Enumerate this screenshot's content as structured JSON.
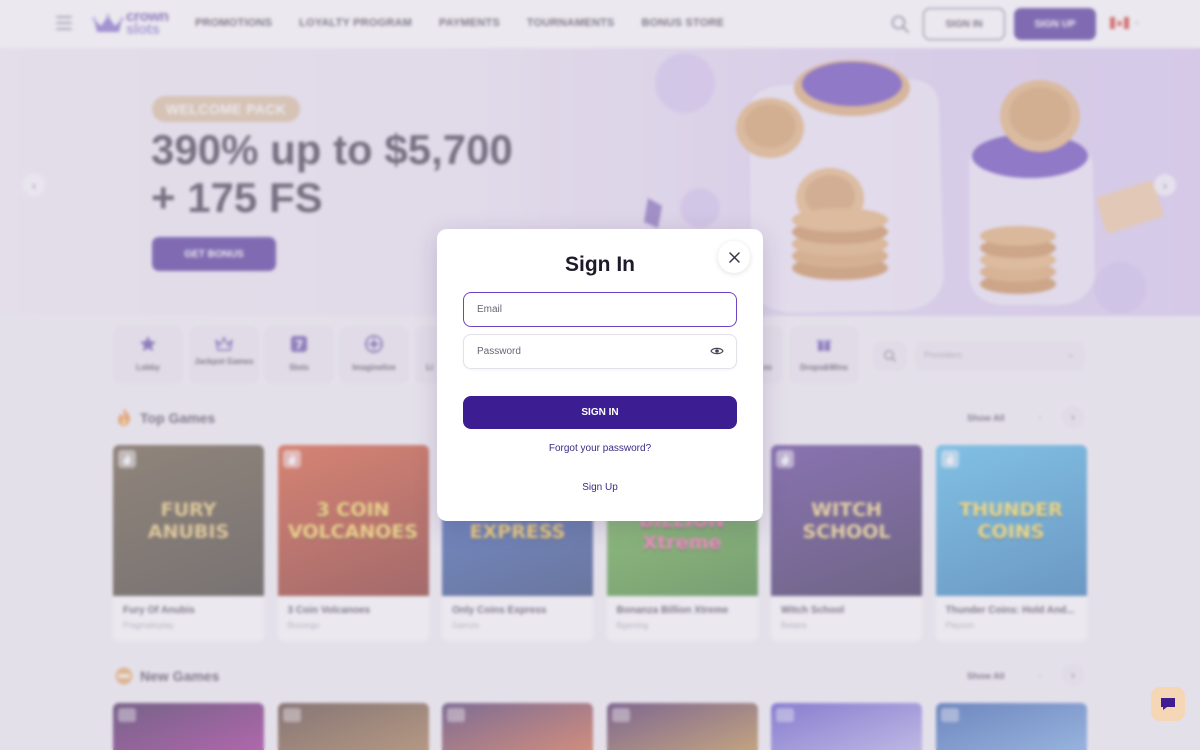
{
  "header": {
    "logo_line1": "crown",
    "logo_line2": "slots",
    "nav": [
      "PROMOTIONS",
      "LOYALTY PROGRAM",
      "PAYMENTS",
      "TOURNAMENTS",
      "BONUS STORE"
    ],
    "sign_in": "SIGN IN",
    "sign_up": "SIGN UP",
    "country_flag": "canada-flag-icon"
  },
  "hero": {
    "badge": "WELCOME PACK",
    "headline_line1": "390% up to $5,700",
    "headline_line2": "+ 175 FS",
    "cta": "GET BONUS"
  },
  "categories": [
    {
      "label": "Lobby",
      "icon": "star-icon"
    },
    {
      "label": "Jackpot Games",
      "icon": "crown-icon"
    },
    {
      "label": "Slots",
      "icon": "slot-7-icon"
    },
    {
      "label": "Imaginelive",
      "icon": "roulette-icon"
    },
    {
      "label": "Li",
      "icon": "live-icon"
    },
    {
      "label": "es",
      "icon": "games-icon"
    },
    {
      "label": "Drops&Wins",
      "icon": "drops-icon"
    }
  ],
  "providers_placeholder": "Providers",
  "top_games": {
    "title": "Top Games",
    "show_all": "Show All",
    "games": [
      {
        "name": "Fury Of Anubis",
        "provider": "Pragmaticplay",
        "art": "FURY ANUBIS",
        "c1": "#5a4a2c",
        "c2": "#2e2a1e",
        "fg": "#e8c66a"
      },
      {
        "name": "3 Coin Volcanoes",
        "provider": "Booongo",
        "art": "3 COIN VOLCANOES",
        "c1": "#d8481f",
        "c2": "#7c1a0f",
        "fg": "#ffd64a"
      },
      {
        "name": "Only Coins Express",
        "provider": "Gamzix",
        "art": "ONLY COINS EXPRESS",
        "c1": "#2a5ec4",
        "c2": "#16306e",
        "fg": "#ffcf3f"
      },
      {
        "name": "Bonanza Billion Xtreme",
        "provider": "Bgaming",
        "art": "BONANZA BILLION Xtreme",
        "c1": "#6cc13a",
        "c2": "#2c7a1e",
        "fg": "#ff5ea8"
      },
      {
        "name": "Witch School",
        "provider": "Belatra",
        "art": "WITCH SCHOOL",
        "c1": "#4e2a8e",
        "c2": "#1d1140",
        "fg": "#f2d37c"
      },
      {
        "name": "Thunder Coins: Hold And...",
        "provider": "Playson",
        "art": "THUNDER COINS",
        "c1": "#3fb6ea",
        "c2": "#186fb0",
        "fg": "#ffe042"
      }
    ]
  },
  "new_games": {
    "title": "New Games",
    "show_all": "Show All",
    "thumbs": [
      {
        "c1": "#2b0d44",
        "c2": "#a0168e"
      },
      {
        "c1": "#4a2f22",
        "c2": "#a5763e"
      },
      {
        "c1": "#3a1f5a",
        "c2": "#e0622c"
      },
      {
        "c1": "#3b1552",
        "c2": "#c49033"
      },
      {
        "c1": "#4a3dc6",
        "c2": "#b8b4f0"
      },
      {
        "c1": "#1e4fa8",
        "c2": "#6fa9e6"
      }
    ]
  },
  "modal": {
    "title": "Sign In",
    "email_placeholder": "Email",
    "password_placeholder": "Password",
    "submit": "SIGN IN",
    "forgot": "Forgot your password?",
    "sign_up": "Sign Up"
  },
  "colors": {
    "brand": "#3d1d92",
    "focus": "#6d45c6",
    "badge": "#d9bc97"
  }
}
